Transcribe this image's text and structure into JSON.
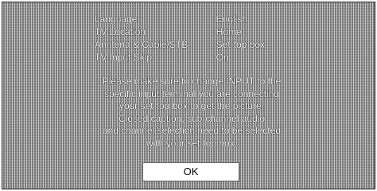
{
  "settings": {
    "rows": [
      {
        "label": "Language",
        "value": ": English"
      },
      {
        "label": "TV Location",
        "value": ": Home"
      },
      {
        "label": "Anntena & Cable/STB",
        "value": ": Set-top box"
      },
      {
        "label": "TV Input Skip",
        "value": ": On"
      }
    ]
  },
  "message": {
    "lines": [
      "Please make sure to change INPUT to the",
      "specific input terminal you are connecting",
      "your set-top box to get the picture.",
      "Closed caption, sub-channel audio",
      "and channel selection need to be selected",
      "with your set-top box."
    ]
  },
  "dialog": {
    "ok_label": "OK"
  }
}
